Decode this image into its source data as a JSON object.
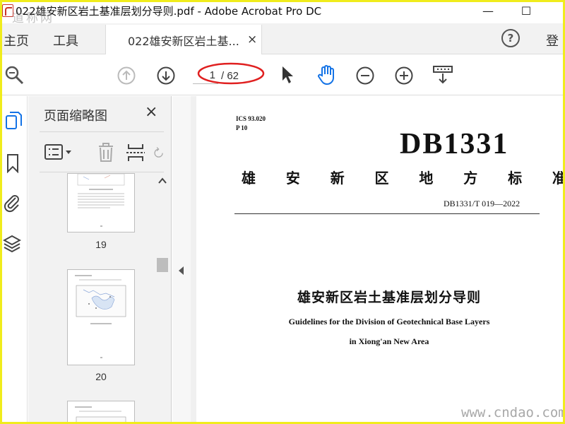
{
  "window": {
    "title": "022雄安新区岩土基准层划分导则.pdf - Adobe Acrobat Pro DC",
    "minimize": "—",
    "maximize": "☐"
  },
  "watermark_top": "道称网",
  "tabs": {
    "home": "主页",
    "tools": "工具",
    "document_tab": "022雄安新区岩土基...",
    "close": "×",
    "help": "?",
    "login": "登"
  },
  "toolbar": {
    "current_page": "1",
    "total_pages": "/ 62"
  },
  "thumbnails_panel": {
    "title": "页面缩略图",
    "close": "×",
    "pages": [
      "19",
      "20"
    ]
  },
  "document": {
    "ics": "ICS 93.020",
    "p": "P 10",
    "code": "DB1331",
    "standard_type_chars": [
      "雄",
      "安",
      "新",
      "区",
      "地",
      "方",
      "标",
      "准"
    ],
    "standard_number": "DB1331/T 019—2022",
    "title_cn": "雄安新区岩土基准层划分导则",
    "title_en_line1": "Guidelines for the Division of Geotechnical Base Layers",
    "title_en_line2": "in Xiong'an New Area"
  },
  "watermark_bottom": "www.cndao.com",
  "colors": {
    "border": "#f0ec1c",
    "annotation_red": "#e02020",
    "hand_tool_blue": "#1473e6"
  }
}
